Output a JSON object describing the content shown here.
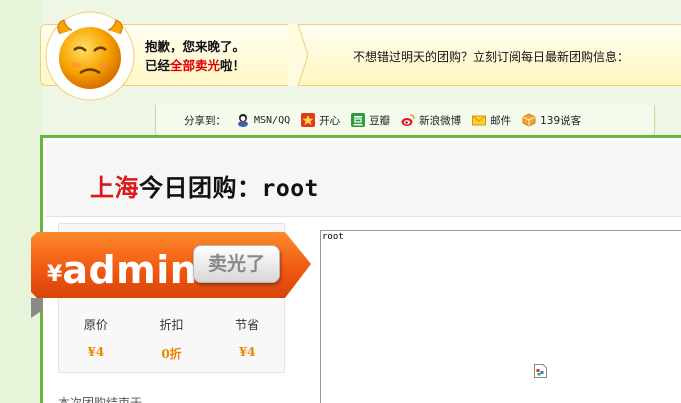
{
  "notice": {
    "line1": "抱歉，您来晚了。",
    "line2_prefix": "已经",
    "line2_highlight": "全部卖光",
    "line2_suffix": "啦！",
    "subscribe_text": "不想错过明天的团购？立刻订阅每日最新团购信息："
  },
  "share": {
    "label": "分享到：",
    "items": [
      {
        "label": "MSN/QQ",
        "icon": "msn-qq-icon"
      },
      {
        "label": "开心",
        "icon": "kaixin-icon"
      },
      {
        "label": "豆瓣",
        "icon": "douban-icon"
      },
      {
        "label": "新浪微博",
        "icon": "sina-weibo-icon"
      },
      {
        "label": "邮件",
        "icon": "mail-icon"
      },
      {
        "label": "139说客",
        "icon": "139-shuoke-icon"
      }
    ]
  },
  "header": {
    "city": "上海",
    "title_middle": "今日团购：",
    "deal_name": "root"
  },
  "price": {
    "currency": "¥",
    "amount": "admin",
    "sold_out_label": "卖光了",
    "stats": [
      {
        "label": "原价",
        "value": "¥4"
      },
      {
        "label": "折扣",
        "value": "0折"
      },
      {
        "label": "节省",
        "value": "¥4"
      }
    ],
    "ended_text": "本次团购结束于"
  },
  "image": {
    "alt_text": "root"
  },
  "colors": {
    "accent_green": "#6db33f",
    "city_red": "#d9191c",
    "ribbon_orange": "#f05a12",
    "value_orange": "#e88600"
  }
}
